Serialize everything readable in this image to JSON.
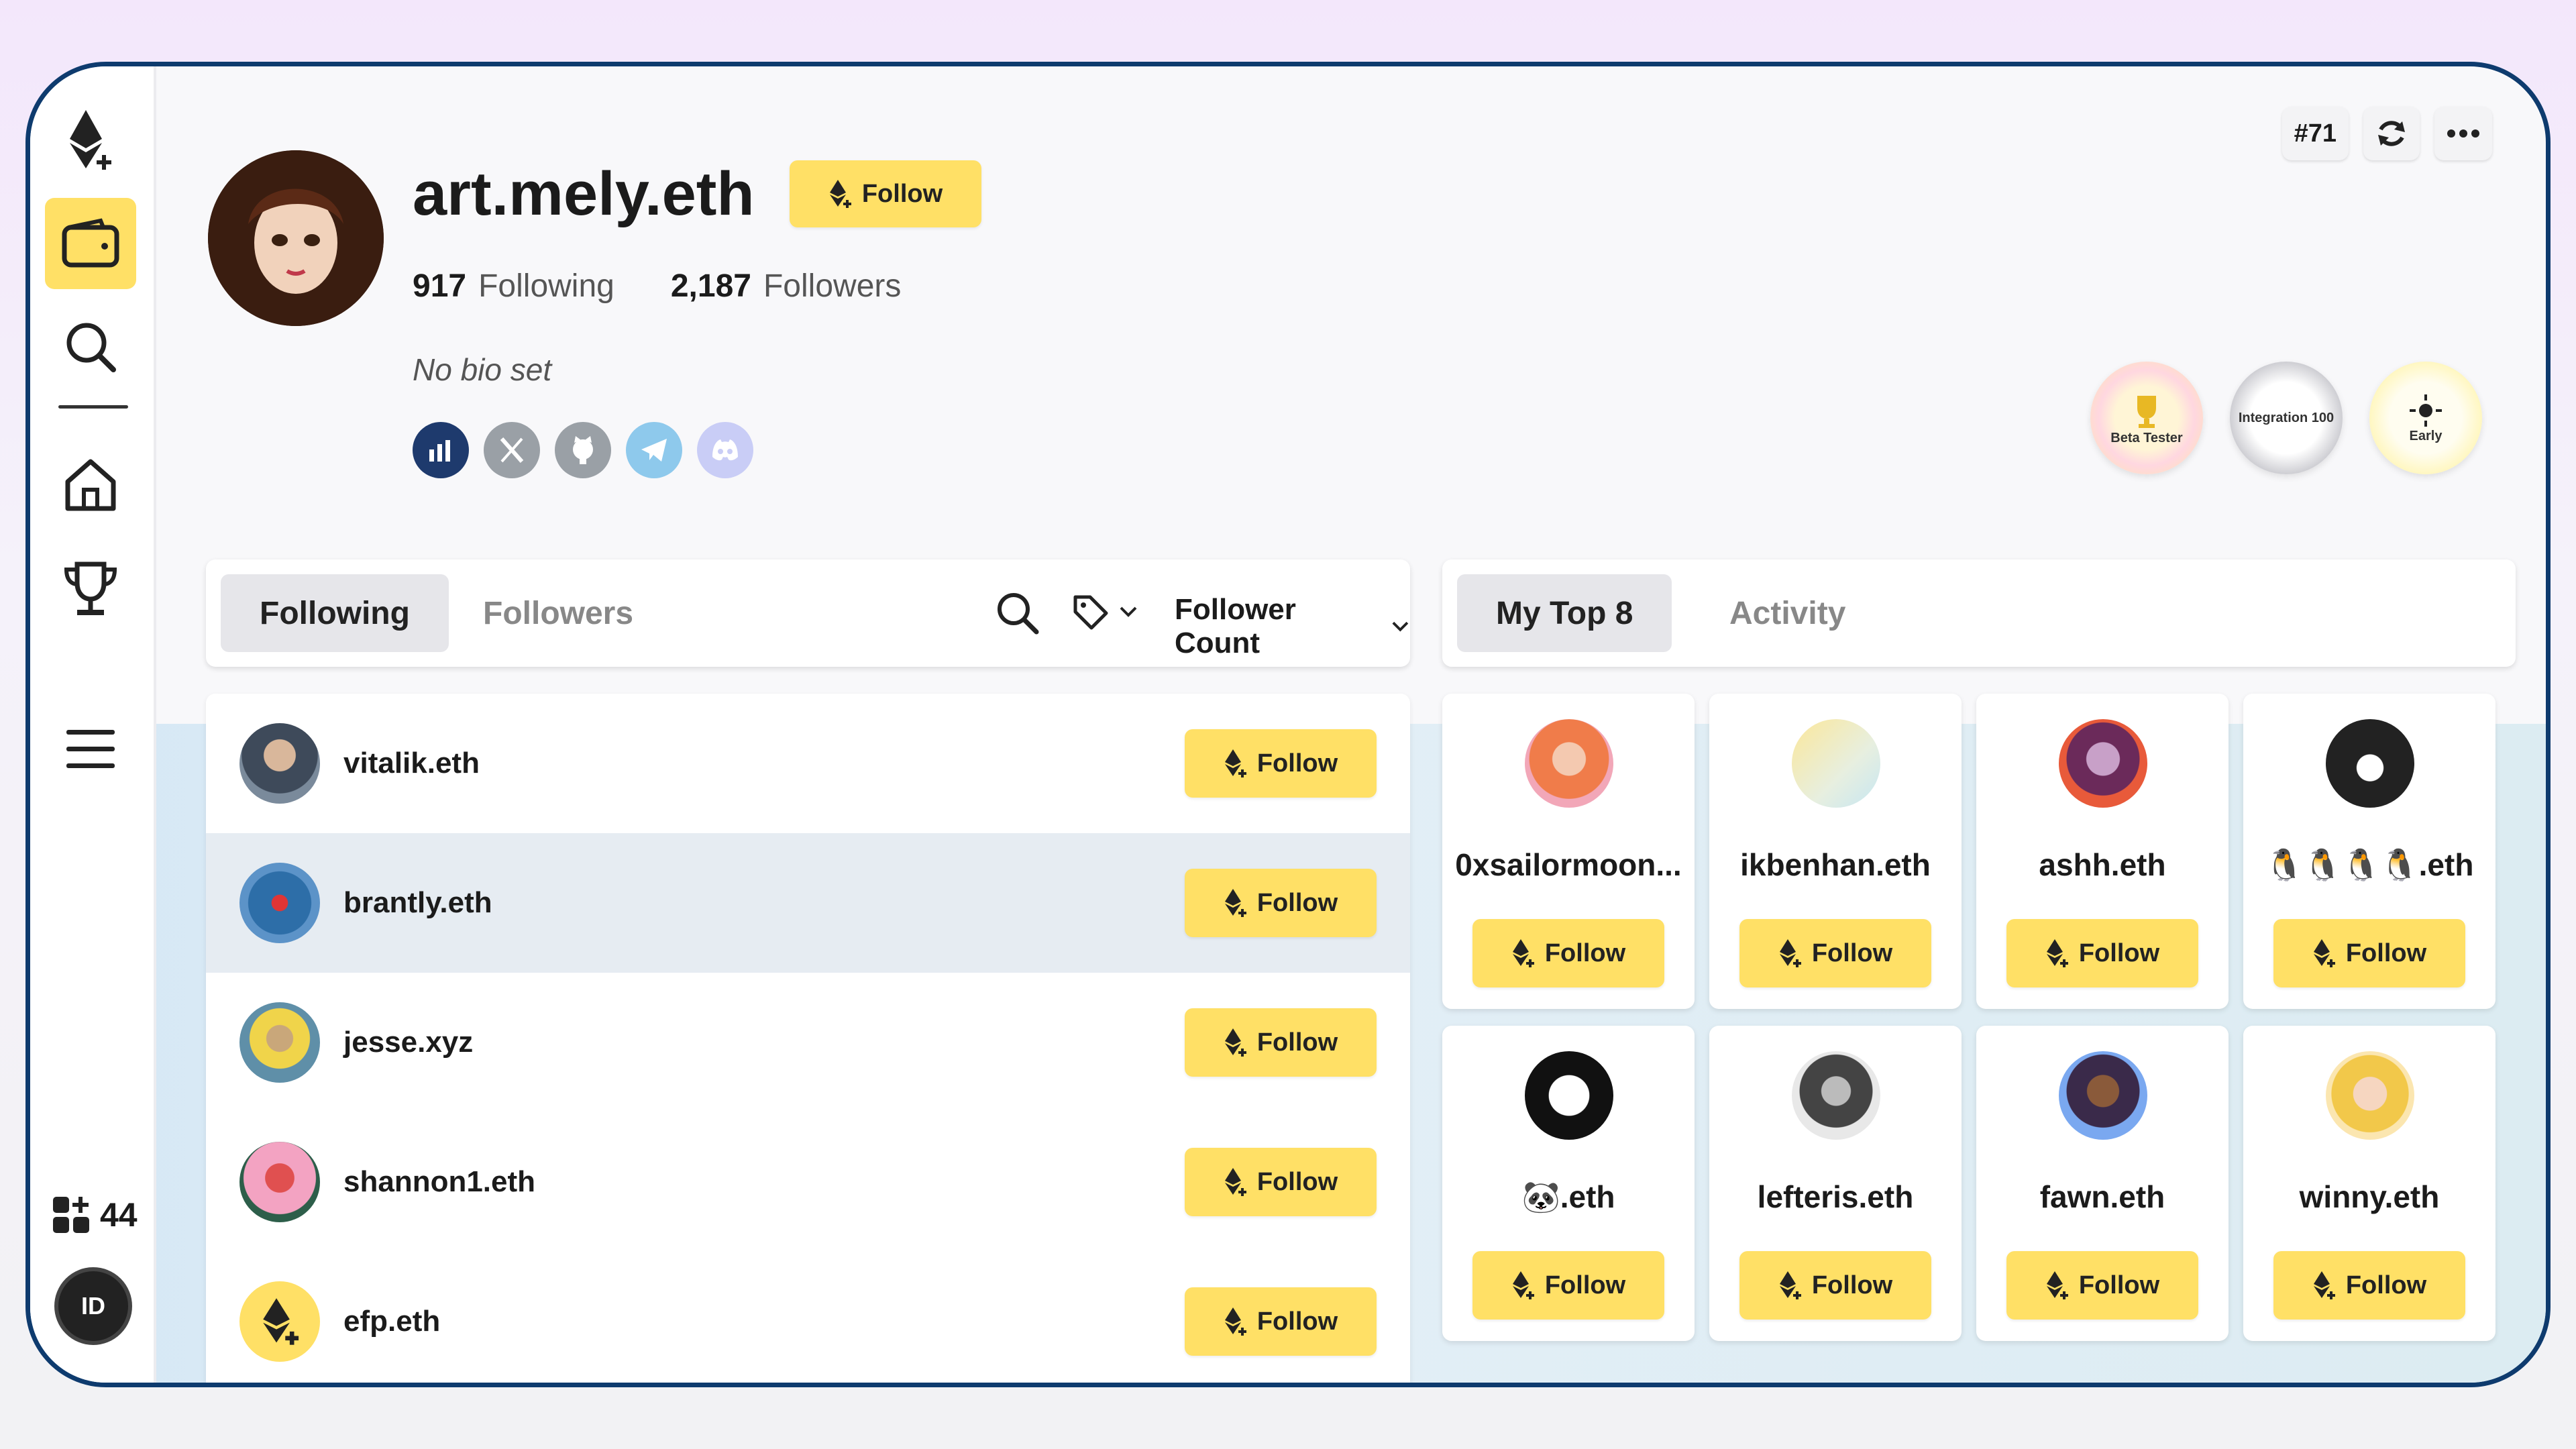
{
  "sidebar": {
    "items": [
      {
        "icon": "efp-logo-icon"
      },
      {
        "icon": "wallet-icon",
        "active": true
      },
      {
        "icon": "search-icon"
      },
      {
        "icon": "home-icon"
      },
      {
        "icon": "trophy-icon"
      },
      {
        "icon": "menu-icon"
      }
    ],
    "app_count": "44",
    "id_badge": "ID"
  },
  "toolbar": {
    "rank": "#71",
    "refresh_icon": "refresh-icon",
    "more_icon": "more-icon"
  },
  "profile": {
    "name": "art.mely.eth",
    "follow_label": "Follow",
    "following_count": "917",
    "following_label": "Following",
    "followers_count": "2,187",
    "followers_label": "Followers",
    "bio": "No bio set",
    "socials": [
      "etherscan-icon",
      "x-icon",
      "github-icon",
      "telegram-icon",
      "discord-icon"
    ],
    "badges": [
      "Beta Tester",
      "Integration 100",
      "Early"
    ]
  },
  "left_panel": {
    "tabs": [
      "Following",
      "Followers"
    ],
    "sort_label": "Follower Count",
    "rows": [
      {
        "name": "vitalik.eth",
        "follow": "Follow"
      },
      {
        "name": "brantly.eth",
        "follow": "Follow"
      },
      {
        "name": "jesse.xyz",
        "follow": "Follow"
      },
      {
        "name": "shannon1.eth",
        "follow": "Follow"
      },
      {
        "name": "efp.eth",
        "follow": "Follow"
      }
    ]
  },
  "right_panel": {
    "tabs": [
      "My Top 8",
      "Activity"
    ],
    "cards": [
      {
        "name": "0xsailormoon...",
        "follow": "Follow"
      },
      {
        "name": "ikbenhan.eth",
        "follow": "Follow"
      },
      {
        "name": "ashh.eth",
        "follow": "Follow"
      },
      {
        "name": "🐧🐧🐧🐧.eth",
        "follow": "Follow"
      },
      {
        "name": "🐼.eth",
        "follow": "Follow"
      },
      {
        "name": "lefteris.eth",
        "follow": "Follow"
      },
      {
        "name": "fawn.eth",
        "follow": "Follow"
      },
      {
        "name": "winny.eth",
        "follow": "Follow"
      }
    ]
  },
  "colors": {
    "accent": "#ffe066",
    "frame": "#0e3b6e"
  }
}
